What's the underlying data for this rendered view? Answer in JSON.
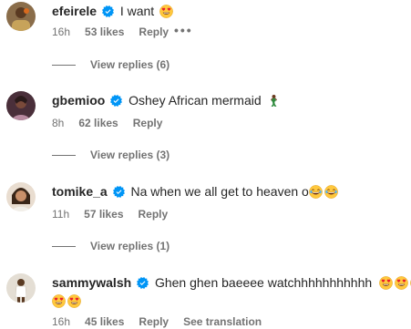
{
  "comments": [
    {
      "username": "efeirele",
      "text": "I want",
      "emoji": [
        "heart-eyes"
      ],
      "time": "16h",
      "likes": "53 likes",
      "reply": "Reply",
      "more": "•••",
      "view_replies": "View replies (6)",
      "avatar_color": "#6b4c2a"
    },
    {
      "username": "gbemioo",
      "text": "Oshey African mermaid",
      "emoji": [
        "mermaid"
      ],
      "time": "8h",
      "likes": "62 likes",
      "reply": "Reply",
      "view_replies": "View replies (3)",
      "avatar_color": "#5a3a4a"
    },
    {
      "username": "tomike_a",
      "text": "Na when we all get to heaven o",
      "emoji": [
        "joy",
        "joy"
      ],
      "time": "11h",
      "likes": "57 likes",
      "reply": "Reply",
      "view_replies": "View replies (1)",
      "avatar_color": "#c9a98a"
    },
    {
      "username": "sammywalsh",
      "text": "Ghen ghen baeeee watchhhhhhhhhhh",
      "emoji": [
        "heart-eyes",
        "heart-eyes",
        "heart-eyes",
        "heart-eyes",
        "heart-eyes"
      ],
      "time": "16h",
      "likes": "45 likes",
      "reply": "Reply",
      "see_translation": "See translation",
      "avatar_color": "#d8d2c8"
    }
  ],
  "colors": {
    "verified_blue": "#0095f6",
    "secondary_text": "#737373",
    "primary_text": "#262626"
  },
  "icons": {
    "verified": "verified-badge-icon",
    "heart_eyes": "heart-eyes-emoji-icon",
    "joy": "joy-emoji-icon",
    "mermaid": "mermaid-emoji-icon"
  }
}
